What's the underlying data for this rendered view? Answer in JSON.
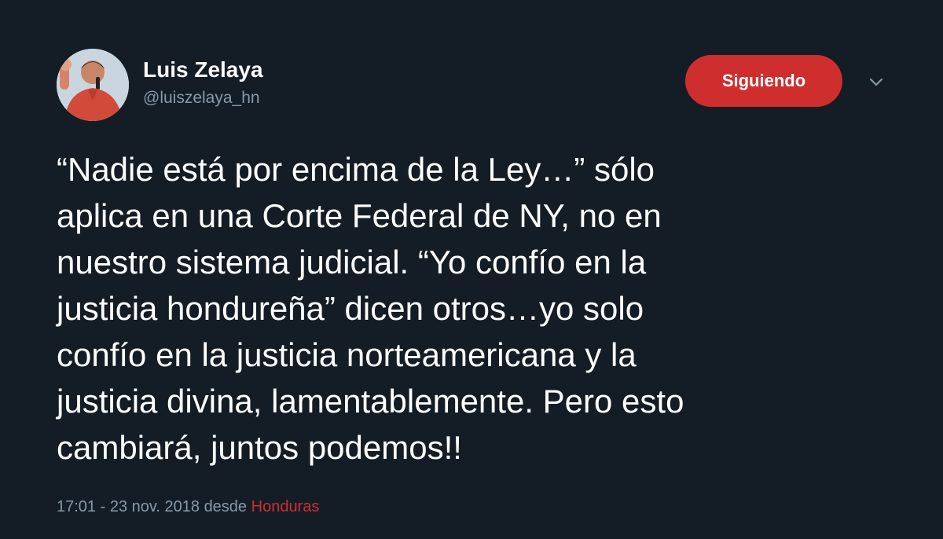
{
  "user": {
    "display_name": "Luis Zelaya",
    "handle": "@luiszelaya_hn"
  },
  "follow_button": {
    "label": "Siguiendo"
  },
  "icons": {
    "menu": "chevron-down-icon"
  },
  "tweet": {
    "text": "“Nadie está por encima de la Ley…” sólo\naplica en una Corte Federal de NY, no en\nnuestro sistema judicial. “Yo confío en la\njusticia hondureña” dicen otros…yo solo\nconfío en la justicia norteamericana y la\njusticia divina, lamentablemente. Pero esto\ncambiará, juntos podemos!!"
  },
  "meta": {
    "timestamp": "17:01 - 23 nov. 2018",
    "via": "desde",
    "place": "Honduras"
  },
  "colors": {
    "background": "#141d26",
    "accent": "#cf2e2e",
    "secondary_text": "#8899a6",
    "primary_text": "#ffffff"
  }
}
